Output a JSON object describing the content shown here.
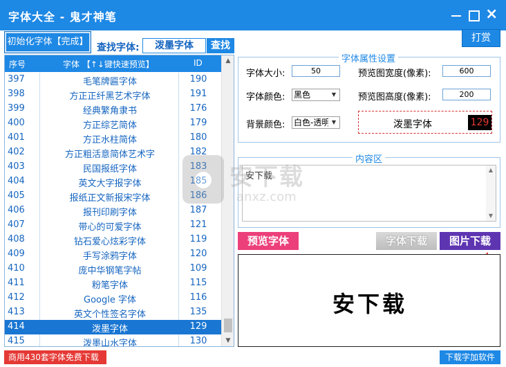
{
  "window": {
    "title": "字体大全 - 鬼才神笔"
  },
  "toolbar": {
    "init_label": "初始化字体【完成】",
    "find_label": "查找字体:",
    "find_value": "泼墨字体",
    "find_button": "查找",
    "donate_button": "打赏"
  },
  "table": {
    "headers": {
      "index": "序号",
      "font": "字体 【↑↓键快速预览】",
      "id": "ID"
    },
    "rows": [
      {
        "index": "397",
        "name": "毛笔牌匾字体",
        "id": "190"
      },
      {
        "index": "398",
        "name": "方正正纤黑艺术字体",
        "id": "191"
      },
      {
        "index": "399",
        "name": "经典繁角隶书",
        "id": "176"
      },
      {
        "index": "400",
        "name": "方正综艺简体",
        "id": "179"
      },
      {
        "index": "401",
        "name": "方正水柱简体",
        "id": "180"
      },
      {
        "index": "402",
        "name": "方正粗活意简体艺术字",
        "id": "182"
      },
      {
        "index": "403",
        "name": "民国报纸字体",
        "id": "183"
      },
      {
        "index": "404",
        "name": "英文大字报字体",
        "id": "185"
      },
      {
        "index": "405",
        "name": "报纸正文新报宋字体",
        "id": "186"
      },
      {
        "index": "406",
        "name": "报刊印刷字体",
        "id": "187"
      },
      {
        "index": "407",
        "name": "带心的可爱字体",
        "id": "121"
      },
      {
        "index": "408",
        "name": "钻石爱心炫彩字体",
        "id": "119"
      },
      {
        "index": "409",
        "name": "手写涂鸦字体",
        "id": "120"
      },
      {
        "index": "410",
        "name": "庞中华钢笔字帖",
        "id": "109"
      },
      {
        "index": "411",
        "name": "粉笔字体",
        "id": "115"
      },
      {
        "index": "412",
        "name": "Google 字体",
        "id": "116"
      },
      {
        "index": "413",
        "name": "英文个性签名字体",
        "id": "135"
      },
      {
        "index": "414",
        "name": "泼墨字体",
        "id": "129"
      },
      {
        "index": "415",
        "name": "泼墨山水字体",
        "id": "130"
      }
    ],
    "selected_index": 17
  },
  "properties": {
    "group_title": "字体属性设置",
    "font_size_label": "字体大小:",
    "font_size_value": "50",
    "preview_width_label": "预览图宽度(像素):",
    "preview_width_value": "600",
    "font_color_label": "字体颜色:",
    "font_color_value": "黑色",
    "preview_height_label": "预览图高度(像素):",
    "preview_height_value": "200",
    "bg_color_label": "背景颜色:",
    "bg_color_value": "白色-透明",
    "selected_font_name": "泼墨字体",
    "selected_font_id": "129"
  },
  "content": {
    "group_title": "内容区",
    "text": "安下载"
  },
  "watermark": {
    "text_cn": "安下载",
    "text_en": "anxz.com"
  },
  "actions": {
    "preview_font": "预览字体",
    "font_download": "字体下载",
    "image_download": "图片下载"
  },
  "preview": {
    "rendered_text": "安下载"
  },
  "footer": {
    "left": "商用430套字体免费下载",
    "right": "下载字加软件"
  },
  "colors": {
    "title_bar": "#1e88e5",
    "accent_blue": "#1e88e5",
    "selected_row": "#1976d2",
    "preview_button": "#ec407a",
    "image_download_button": "#5e35b1",
    "footer_left": "#e53935",
    "arrow": "#e53935"
  }
}
